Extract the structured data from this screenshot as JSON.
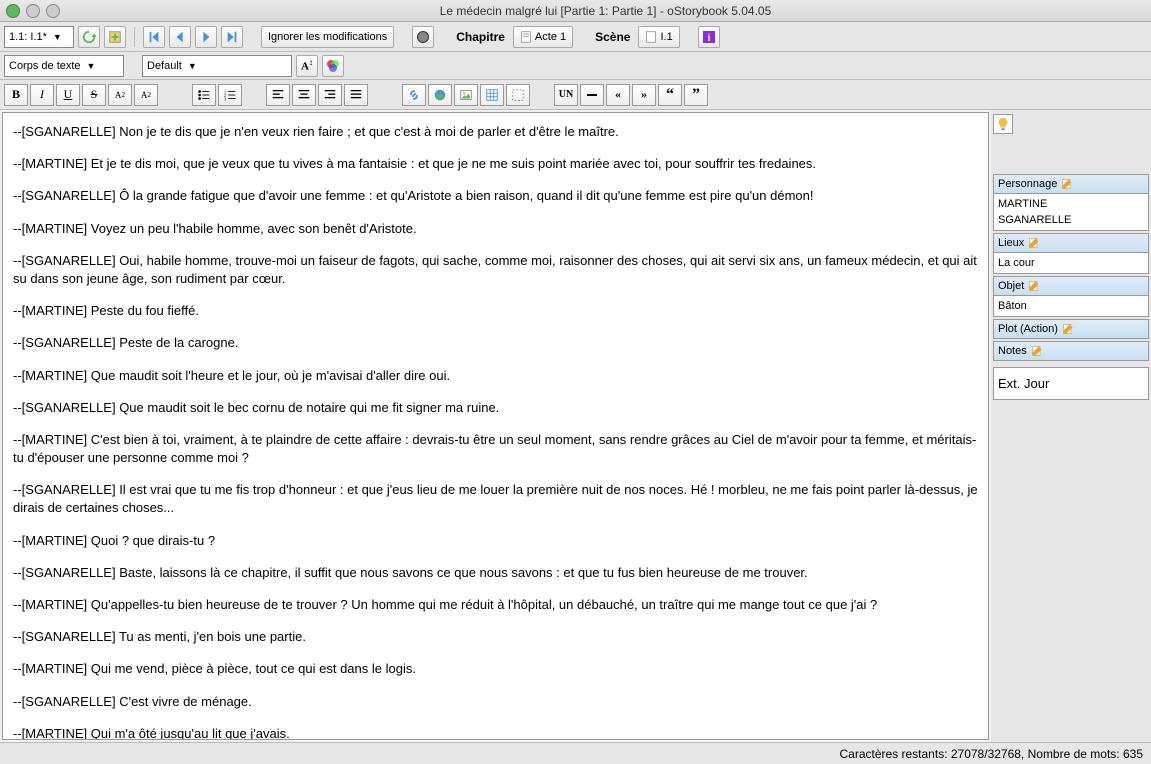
{
  "window": {
    "title": "Le médecin malgré lui [Partie 1: Partie 1] - oStorybook 5.04.05"
  },
  "toolbar": {
    "scene_combo": "1.1: I.1*",
    "ignore_mods": "Ignorer les modifications",
    "chapitre": "Chapitre",
    "acte": "Acte 1",
    "scene": "Scène",
    "scene_val": "I.1"
  },
  "format": {
    "style_combo": "Corps de texte",
    "font_combo": "Default",
    "bold": "B",
    "italic": "I",
    "underline": "U",
    "strike": "S",
    "sub": "A₂",
    "sup": "A²",
    "un": "UN",
    "quote1": "«",
    "quote2": "»",
    "quote3": "‹‹",
    "quote4": "››"
  },
  "editor": {
    "lines": [
      "--[SGANARELLE] Non je te dis que je n'en veux rien faire ; et que c'est à moi de parler et d'être le maître.",
      "--[MARTINE] Et je te dis moi, que je veux que tu vives à ma fantaisie : et que je ne me suis point mariée avec toi, pour souffrir tes fredaines.",
      "--[SGANARELLE] Ô la grande fatigue que d'avoir une femme : et qu'Aristote a bien raison, quand il dit qu'une femme est pire qu'un démon!",
      "--[MARTINE] Voyez un peu l'habile homme, avec son benêt d'Aristote.",
      "--[SGANARELLE] Oui, habile homme, trouve-moi un faiseur de fagots, qui sache, comme moi, raisonner des choses, qui ait servi six ans, un fameux médecin, et qui ait su dans son jeune âge, son rudiment par cœur.",
      "--[MARTINE] Peste du fou fieffé.",
      "--[SGANARELLE] Peste de la carogne.",
      "--[MARTINE] Que maudit soit l'heure et le jour, où je m'avisai d'aller dire oui.",
      "--[SGANARELLE] Que maudit soit le bec cornu de notaire qui me fit signer ma ruine.",
      "--[MARTINE] C'est bien à toi, vraiment, à te plaindre de cette affaire : devrais-tu être un seul moment, sans rendre grâces au Ciel de m'avoir pour ta femme, et méritais-tu d'épouser une personne comme moi ?",
      "--[SGANARELLE] Il est vrai que tu me fis trop d'honneur : et que j'eus lieu de me louer la première nuit de nos noces. Hé ! morbleu, ne me fais point parler là-dessus, je dirais de certaines choses...",
      "--[MARTINE] Quoi ? que dirais-tu ?",
      "--[SGANARELLE] Baste, laissons là ce chapitre, il suffit que nous savons ce que nous savons : et que tu fus bien heureuse de me trouver.",
      "--[MARTINE] Qu'appelles-tu bien heureuse de te trouver ? Un homme qui me réduit à l'hôpital, un débauché, un traître qui me mange tout ce que j'ai ?",
      "--[SGANARELLE] Tu as menti, j'en bois une partie.",
      "--[MARTINE] Qui me vend, pièce à pièce, tout ce qui est dans le logis.",
      "--[SGANARELLE] C'est vivre de ménage.",
      "--[MARTINE] Qui m'a ôté jusqu'au lit que j'avais."
    ]
  },
  "sidebar": {
    "personnage": {
      "label": "Personnage",
      "items": [
        "MARTINE",
        "SGANARELLE"
      ]
    },
    "lieux": {
      "label": "Lieux",
      "items": [
        "La cour"
      ]
    },
    "objet": {
      "label": "Objet",
      "items": [
        "Bâton"
      ]
    },
    "plot": {
      "label": "Plot (Action)"
    },
    "notes": {
      "label": "Notes"
    },
    "ext": "Ext. Jour"
  },
  "status": {
    "text": "Caractères restants: 27078/32768, Nombre de mots: 635"
  }
}
